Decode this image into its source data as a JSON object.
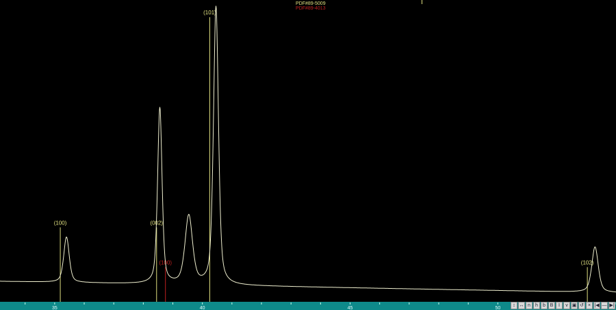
{
  "header": {
    "pdf_cards": [
      {
        "label": "PDF#89-5009",
        "color": "#e0e080"
      },
      {
        "label": "PDF#89-4013",
        "color": "#c02020"
      }
    ]
  },
  "chart_data": {
    "type": "line",
    "title": "",
    "xlabel": "",
    "ylabel": "",
    "xlim": [
      33.15,
      54.0
    ],
    "ylim": [
      0,
      100
    ],
    "grid": false,
    "x_ticks": [
      35,
      40,
      45,
      50
    ],
    "colors": {
      "background": "#000000",
      "pattern": "#f0f0d0",
      "ref1": "#e0e080",
      "ref2": "#c02020",
      "axis": "#0e8a8a"
    },
    "baseline": {
      "start": 6,
      "end": 2
    },
    "peaks": [
      {
        "two_theta": 35.4,
        "intensity": 16,
        "fwhm": 0.22
      },
      {
        "two_theta": 38.56,
        "intensity": 62,
        "fwhm": 0.18
      },
      {
        "two_theta": 39.54,
        "intensity": 24,
        "fwhm": 0.3
      },
      {
        "two_theta": 40.46,
        "intensity": 98,
        "fwhm": 0.2
      },
      {
        "two_theta": 53.29,
        "intensity": 16,
        "fwhm": 0.26
      }
    ],
    "reference_lines": [
      {
        "two_theta": 35.19,
        "intensity": 25,
        "label": "(100)",
        "card": 0
      },
      {
        "two_theta": 38.45,
        "intensity": 25,
        "label": "(002)",
        "card": 0
      },
      {
        "two_theta": 40.25,
        "intensity": 99,
        "label": "(101)",
        "card": 0
      },
      {
        "two_theta": 53.03,
        "intensity": 11,
        "label": "(102)",
        "card": 0
      },
      {
        "two_theta": 38.75,
        "intensity": 11,
        "label": "(100)",
        "card": 1
      }
    ]
  },
  "toolbar": {
    "buttons": [
      "↕",
      "↔",
      "n",
      "h",
      "b",
      "B",
      "I",
      "v",
      "▣",
      "↺",
      "×",
      "|◀",
      "—",
      "▶|"
    ]
  }
}
